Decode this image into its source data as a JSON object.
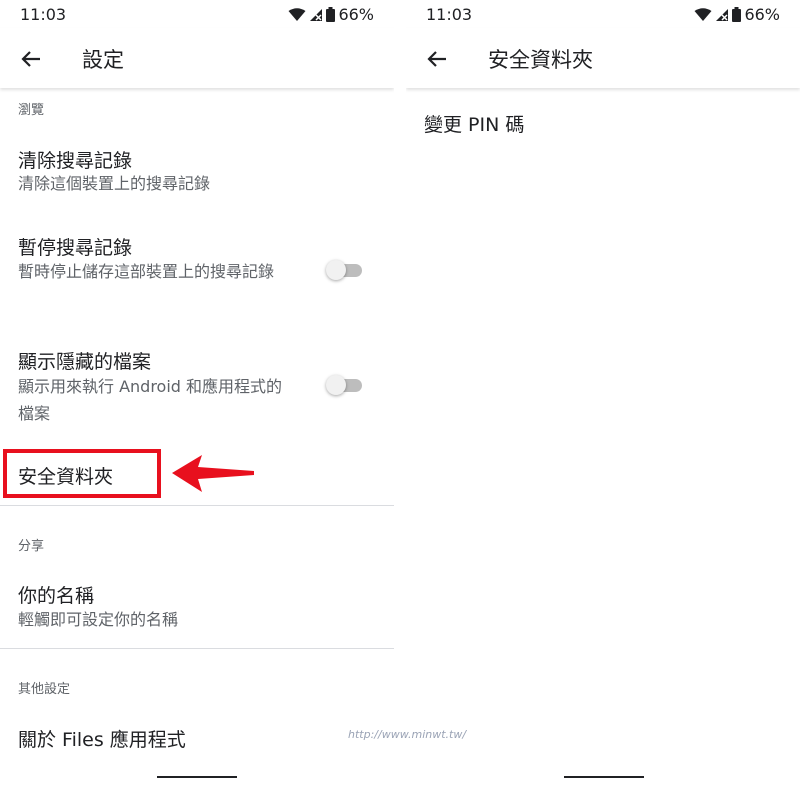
{
  "status": {
    "time": "11:03",
    "battery": "66%"
  },
  "left": {
    "title": "設定",
    "sections": {
      "browse": "瀏覽",
      "share": "分享",
      "other": "其他設定"
    },
    "items": {
      "clear_history": {
        "title": "清除搜尋記錄",
        "subtitle": "清除這個裝置上的搜尋記錄"
      },
      "pause_history": {
        "title": "暫停搜尋記錄",
        "subtitle": "暫時停止儲存這部裝置上的搜尋記錄"
      },
      "show_hidden": {
        "title": "顯示隱藏的檔案",
        "subtitle": "顯示用來執行 Android 和應用程式的檔案"
      },
      "safe_folder": {
        "title": "安全資料夾"
      },
      "your_name": {
        "title": "你的名稱",
        "subtitle": "輕觸即可設定你的名稱"
      },
      "about": {
        "title": "關於 Files 應用程式"
      }
    }
  },
  "right": {
    "title": "安全資料夾",
    "items": {
      "change_pin": "變更 PIN 碼"
    }
  },
  "watermark": "http://www.minwt.tw/",
  "colors": {
    "highlight": "#e8101e",
    "divider": "#dadce0",
    "subtext": "#5f6368"
  }
}
